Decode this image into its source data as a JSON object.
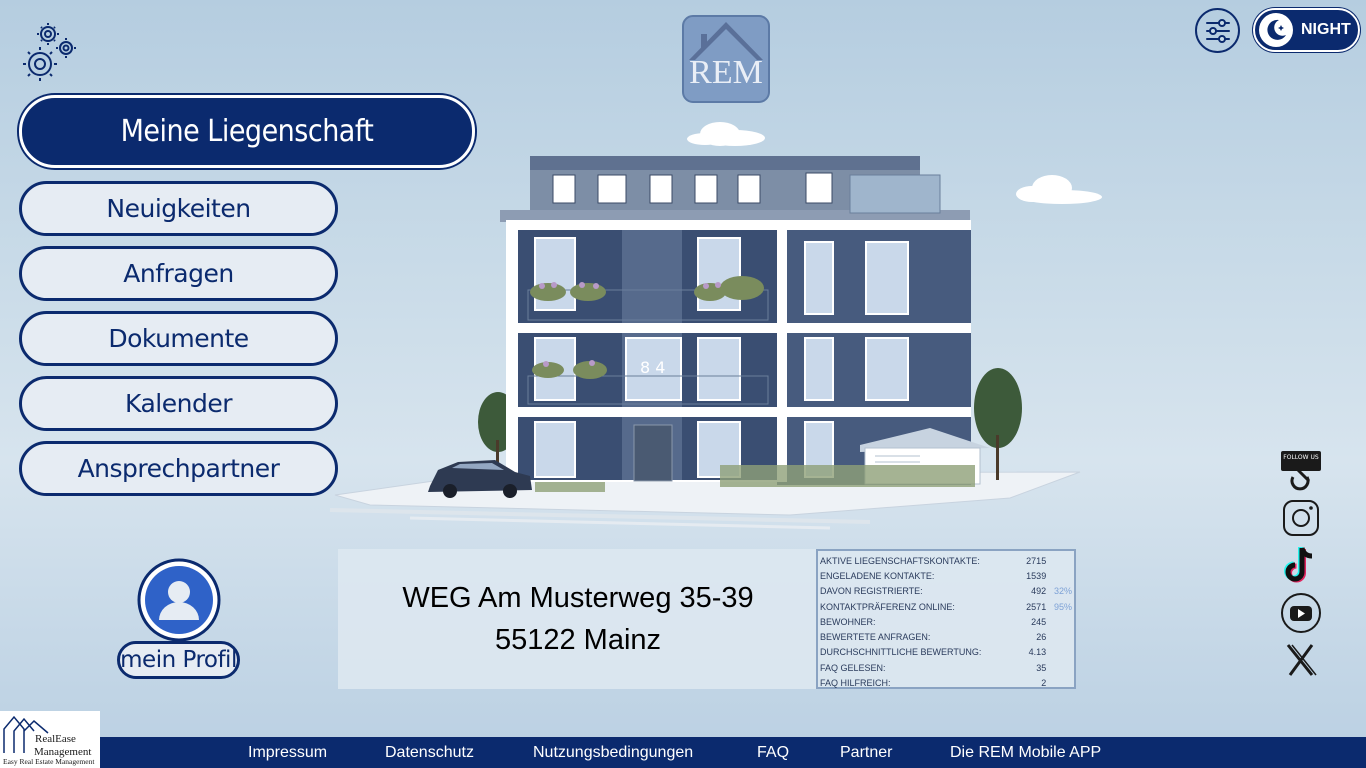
{
  "logo": {
    "text": "REM"
  },
  "nav": {
    "main": "Meine Liegenschaft",
    "items": [
      "Neuigkeiten",
      "Anfragen",
      "Dokumente",
      "Kalender",
      "Ansprechpartner"
    ]
  },
  "night_toggle": {
    "label": "NIGHT"
  },
  "building": {
    "sign": "8 4"
  },
  "address": {
    "line1": "WEG Am Musterweg 35-39",
    "line2": "55122 Mainz"
  },
  "stats": [
    {
      "label": "AKTIVE LIEGENSCHAFTSKONTAKTE:",
      "value": "2715",
      "pct": ""
    },
    {
      "label": "ENGELADENE KONTAKTE:",
      "value": "1539",
      "pct": ""
    },
    {
      "label": "DAVON REGISTRIERTE:",
      "value": "492",
      "pct": "32%"
    },
    {
      "label": "KONTAKTPRÄFERENZ ONLINE:",
      "value": "2571",
      "pct": "95%"
    },
    {
      "label": "BEWOHNER:",
      "value": "245",
      "pct": ""
    },
    {
      "label": "BEWERTETE ANFRAGEN:",
      "value": "26",
      "pct": ""
    },
    {
      "label": "DURCHSCHNITTLICHE BEWERTUNG:",
      "value": "4.13",
      "pct": ""
    },
    {
      "label": "FAQ GELESEN:",
      "value": "35",
      "pct": ""
    },
    {
      "label": "FAQ HILFREICH:",
      "value": "2",
      "pct": ""
    }
  ],
  "profile": {
    "label": "mein Profil"
  },
  "social": {
    "follow": "FOLLOW US"
  },
  "footer": {
    "links": [
      "Impressum",
      "Datenschutz",
      "Nutzungsbedingungen",
      "FAQ",
      "Partner",
      "Die REM Mobile APP"
    ]
  },
  "brand": {
    "name1": "RealEase",
    "name2": "Management",
    "tagline": "Easy Real Estate Management"
  },
  "colors": {
    "primary": "#0b2a6e",
    "background": "#c9dbe8",
    "nav_item_bg": "#e6ecf3"
  }
}
